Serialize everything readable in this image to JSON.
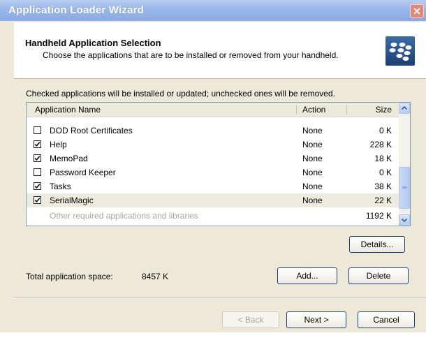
{
  "window": {
    "title": "Application Loader Wizard",
    "close_glyph": "✕"
  },
  "header": {
    "title": "Handheld Application Selection",
    "subtitle": "Choose the applications that are to be installed or removed from your handheld.",
    "logo_icon": "blackberry-logo-icon"
  },
  "instruction": "Checked applications will be installed or updated; unchecked ones will be removed.",
  "list": {
    "columns": {
      "name": "Application Name",
      "action": "Action",
      "size": "Size"
    },
    "rows": [
      {
        "name": "DOD Root Certificates",
        "action": "None",
        "size": "0 K",
        "checked": false
      },
      {
        "name": "Help",
        "action": "None",
        "size": "228 K",
        "checked": true
      },
      {
        "name": "MemoPad",
        "action": "None",
        "size": "18 K",
        "checked": true
      },
      {
        "name": "Password Keeper",
        "action": "None",
        "size": "0 K",
        "checked": false
      },
      {
        "name": "Tasks",
        "action": "None",
        "size": "38 K",
        "checked": true
      },
      {
        "name": "SerialMagic",
        "action": "None",
        "size": "22 K",
        "checked": true
      }
    ],
    "footer_row": {
      "name": "Other required applications and libraries",
      "size": "1192 K"
    }
  },
  "buttons": {
    "details": "Details...",
    "add": "Add...",
    "delete": "Delete",
    "back": "< Back",
    "next": "Next >",
    "cancel": "Cancel"
  },
  "total": {
    "label": "Total application space:",
    "value": "8457 K"
  }
}
